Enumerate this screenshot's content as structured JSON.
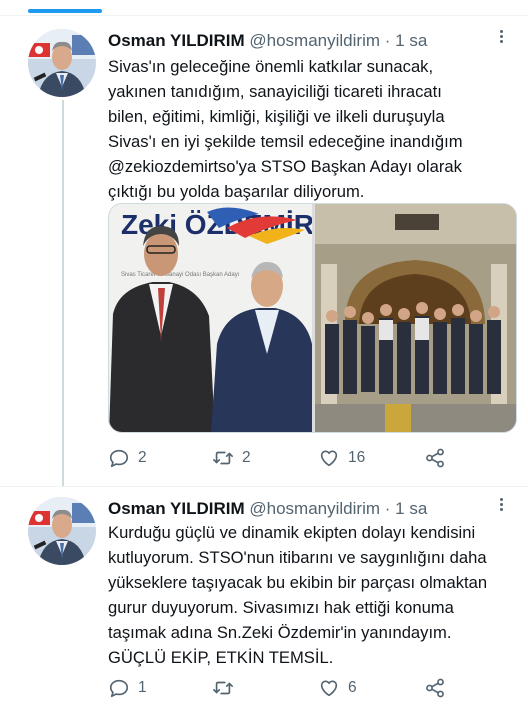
{
  "tweets": [
    {
      "name": "Osman YILDIRIM",
      "handle": "@hosmanyildirim",
      "separator": "·",
      "time": "1 sa",
      "lines": [
        "Sivas'ın geleceğine önemli katkılar sunacak,",
        "yakınen tanıdığım, sanayiciliği ticareti ihracatı",
        "bilen, eğitimi, kimliği, kişiliği ve ilkeli duruşuyla",
        "Sivas'ı en iyi şekilde temsil edeceğine inandığım",
        "@zekiozdemirtso'ya STSO Başkan Adayı olarak",
        "çıktığı bu yolda başarılar diliyorum."
      ],
      "media": {
        "photo1_logo_text": "Zeki ÖZDEMİR",
        "photo1_caption": "Sivas Ticaret ve Sanayi Odası Başkan Adayı"
      },
      "actions": {
        "replies": "2",
        "retweets": "2",
        "likes": "16"
      }
    },
    {
      "name": "Osman YILDIRIM",
      "handle": "@hosmanyildirim",
      "separator": "·",
      "time": "1 sa",
      "lines": [
        "Kurduğu güçlü ve dinamik ekipten dolayı kendisini",
        "kutluyorum. STSO'nun itibarını ve saygınlığını daha",
        "yükseklere taşıyacak bu ekibin bir parçası olmaktan",
        "gurur duyuyorum. Sivasımızı hak ettiği konuma",
        "taşımak adına Sn.Zeki Özdemir'in yanındayım.",
        "GÜÇLÜ EKİP, ETKİN TEMSİL."
      ],
      "actions": {
        "replies": "1",
        "retweets": "",
        "likes": "6"
      }
    }
  ],
  "icons": {
    "reply": "reply-icon",
    "retweet": "retweet-icon",
    "like": "like-icon",
    "share": "share-icon",
    "more": "more-icon"
  },
  "colors": {
    "accent": "#1d9bf0",
    "text": "#0f1419",
    "secondary": "#536471",
    "divider": "#eff3f4"
  }
}
